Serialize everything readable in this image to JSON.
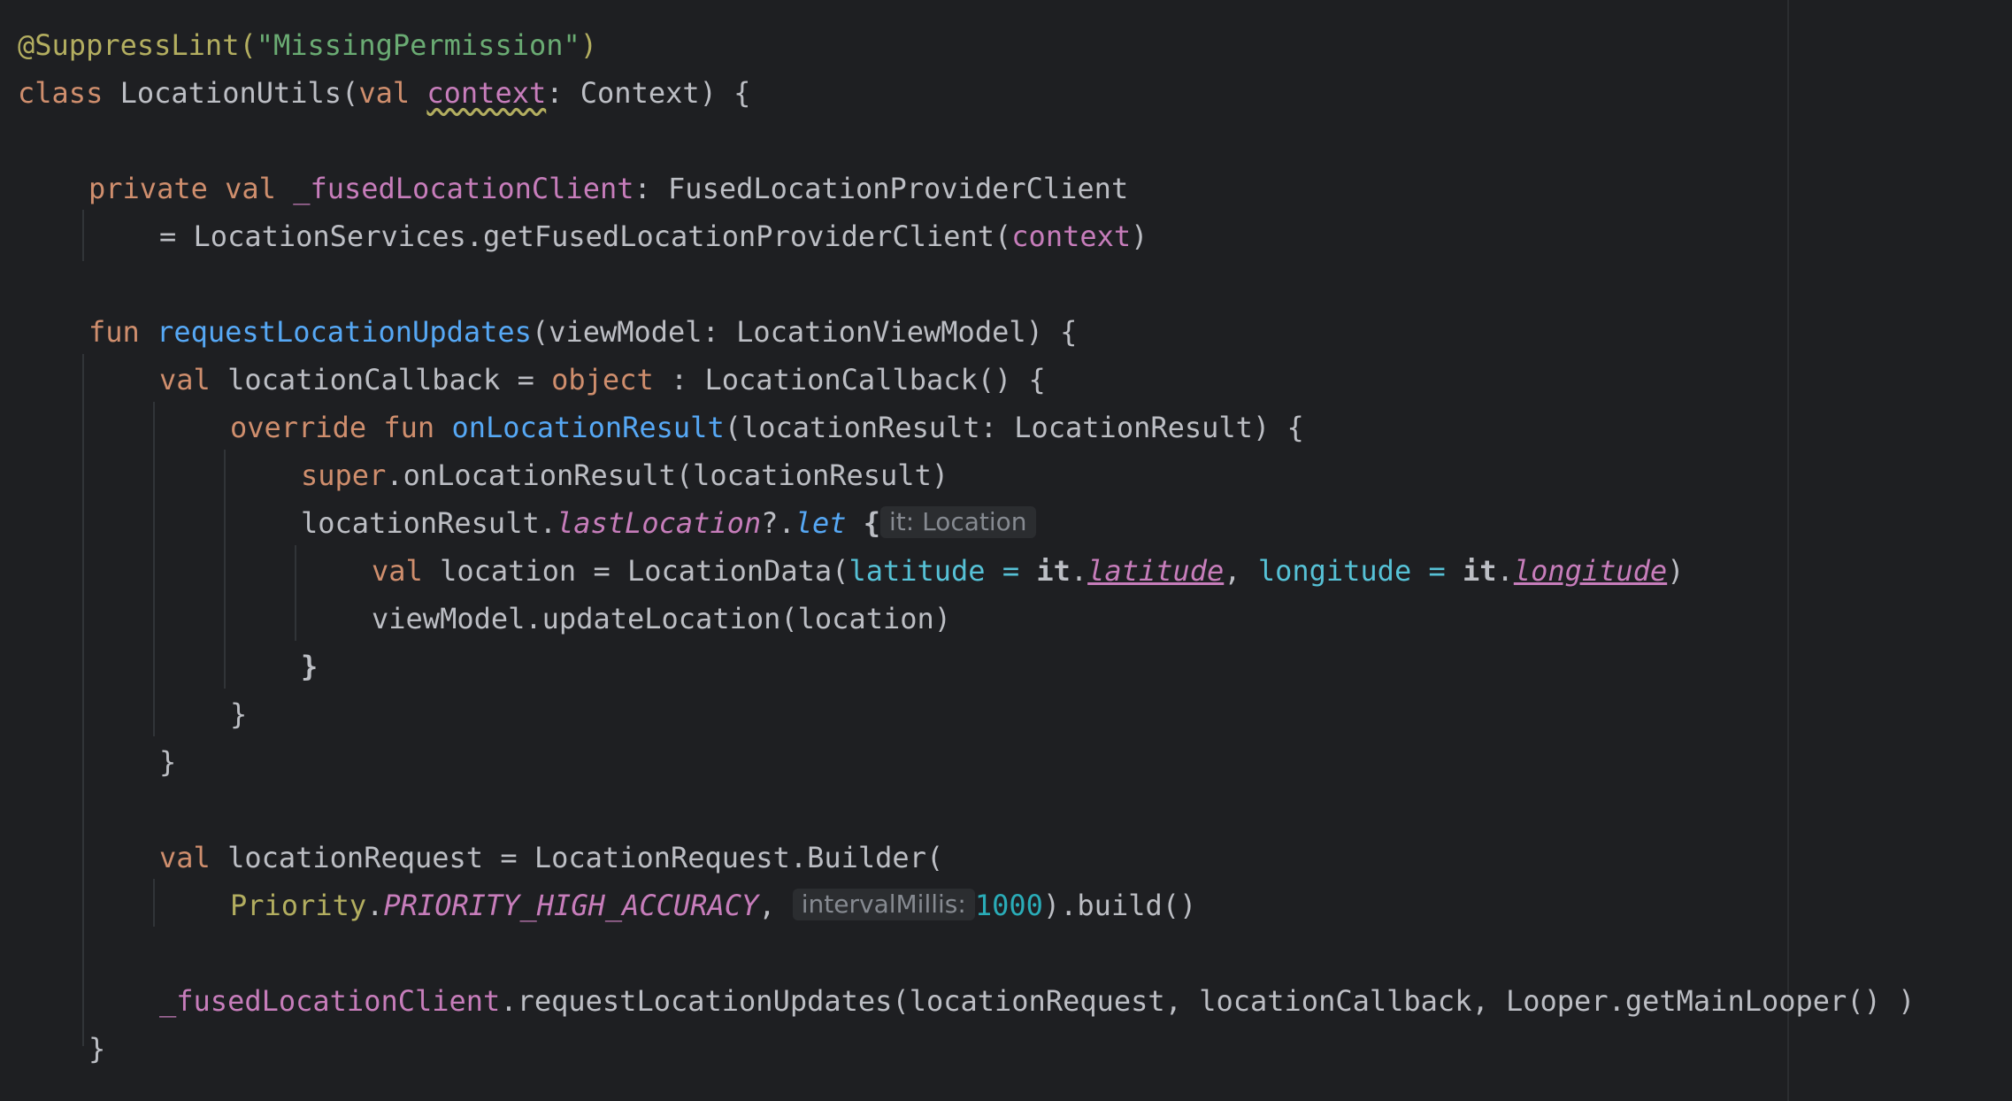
{
  "editor": {
    "lines": {
      "l1": {
        "annotation": "@SuppressLint(",
        "string": "\"MissingPermission\"",
        "close": ")"
      },
      "l2": {
        "kw_class": "class",
        "name": " LocationUtils(",
        "kw_val": "val",
        "param": "context",
        "rest": ": Context) {"
      },
      "l4": {
        "kw_private": "private",
        "kw_val": "val",
        "prop": "_fusedLocationClient",
        "type": ": FusedLocationProviderClient"
      },
      "l5": {
        "text": "= LocationServices.getFusedLocationProviderClient(",
        "arg": "context",
        "close": ")"
      },
      "l7": {
        "kw_fun": "fun",
        "fn": "requestLocationUpdates",
        "rest": "(viewModel: LocationViewModel) {"
      },
      "l8": {
        "kw_val": "val",
        "name": " locationCallback = ",
        "kw_object": "object",
        "rest": " : LocationCallback() {"
      },
      "l9": {
        "kw_override": "override",
        "kw_fun": "fun",
        "fn": "onLocationResult",
        "rest": "(locationResult: LocationResult) {"
      },
      "l10": {
        "kw_super": "super",
        "rest": ".onLocationResult(locationResult)"
      },
      "l11": {
        "obj": "locationResult.",
        "prop": "lastLocation",
        "op": "?.",
        "let": "let",
        "brace": "{",
        "hint": "it: Location"
      },
      "l12": {
        "kw_val": "val",
        "name": " location = LocationData(",
        "named_lat": "latitude = ",
        "it1": "it",
        "dot1": ".",
        "prop_lat": "latitude",
        "comma": ", ",
        "named_lon": "longitude = ",
        "it2": "it",
        "dot2": ".",
        "prop_lon": "longitude",
        "close": ")"
      },
      "l13": {
        "text": "viewModel.updateLocation(location)"
      },
      "l14": {
        "text": "}"
      },
      "l15": {
        "text": "}"
      },
      "l16": {
        "text": "}"
      },
      "l18": {
        "kw_val": "val",
        "rest": " locationRequest = LocationRequest.Builder("
      },
      "l19": {
        "cls": "Priority",
        "dot": ".",
        "const": "PRIORITY_HIGH_ACCURACY",
        "comma": ", ",
        "hint": "intervalMillis:",
        "num": "1000",
        "rest": ").build()"
      },
      "l21": {
        "prop": "_fusedLocationClient",
        "rest": ".requestLocationUpdates(locationRequest, locationCallback, Looper.getMainLooper() )"
      },
      "l22": {
        "text": "}"
      }
    }
  }
}
